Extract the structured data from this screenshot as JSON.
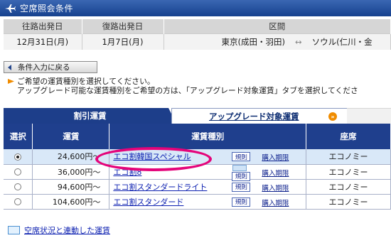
{
  "header": {
    "title": "空席照会条件"
  },
  "conditions": {
    "headers": [
      "往路出発日",
      "復路出発日",
      "区間"
    ],
    "outbound_date": "12月31日(月)",
    "return_date": "1月7日(月)",
    "route_from": "東京(成田・羽田)",
    "route_arrow": "↔",
    "route_to": "ソウル(仁川・金"
  },
  "back_button": {
    "label": "条件入力に戻る"
  },
  "instructions": {
    "line1": "ご希望の運賃種別を選択してください。",
    "line2": "アップグレード可能な運賃種別をご希望の方は、「アップグレード対象運賃」タブを選択してくださ"
  },
  "tabs": {
    "active": "割引運賃",
    "inactive": "アップグレード対象運賃",
    "info_mark": "»"
  },
  "table": {
    "headers": [
      "選択",
      "運賃",
      "運賃種別",
      "座席"
    ],
    "rule_label": "規則",
    "period_label": "購入期限",
    "rows": [
      {
        "selected": true,
        "price": "24,600円〜",
        "fare_type": "エコ割韓国スペシャル",
        "seat": "エコノミー"
      },
      {
        "selected": false,
        "price": "36,000円〜",
        "fare_type": "エコ割8",
        "seat": "エコノミー"
      },
      {
        "selected": false,
        "price": "94,600円〜",
        "fare_type": "エコ割スタンダードライト",
        "seat": "エコノミー"
      },
      {
        "selected": false,
        "price": "104,600円〜",
        "fare_type": "エコ割スタンダード",
        "seat": "エコノミー"
      }
    ]
  },
  "footer": {
    "link": "空席状況と連動した運賃"
  },
  "colors": {
    "header_blue": "#1f3f8d",
    "link": "#0b1fb0",
    "highlight": "#e4047a",
    "accent_orange": "#f08c00"
  }
}
